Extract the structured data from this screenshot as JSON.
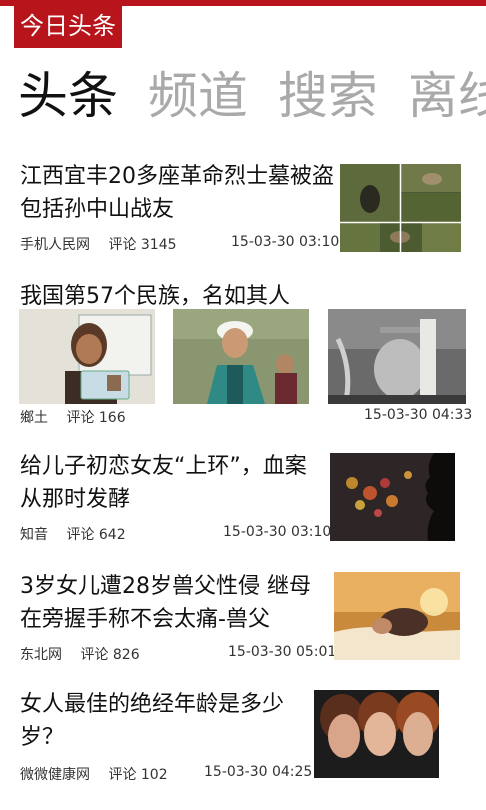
{
  "app": {
    "brand": "今日头条"
  },
  "tabs": [
    {
      "label": "头条",
      "active": true
    },
    {
      "label": "频道",
      "active": false
    },
    {
      "label": "搜索",
      "active": false
    },
    {
      "label": "离线",
      "active": false
    }
  ],
  "articles": [
    {
      "title": "江西宜丰20多座革命烈士墓被盗 包括孙中山战友",
      "source": "手机人民网",
      "comments": "评论 3145",
      "time": "15-03-30 03:10",
      "image": "graves-collage-image"
    },
    {
      "title": "我国第57个民族，名如其人",
      "source": "鄉土",
      "comments": "评论 166",
      "time": "15-03-30 04:33",
      "images": [
        "woman-id-card-image",
        "woman-traditional-dress-image",
        "bamboo-basket-image"
      ]
    },
    {
      "title": "给儿子初恋女友“上环”，血案从那时发酵",
      "source": "知音",
      "comments": "评论 642",
      "time": "15-03-30 03:10",
      "image": "silhouette-bokeh-image"
    },
    {
      "title": "3岁女儿遭28岁兽父性侵 继母在旁握手称不会太痛-兽父",
      "source": "东北网",
      "comments": "评论 826",
      "time": "15-03-30 05:01",
      "image": "bedroom-image"
    },
    {
      "title": "女人最佳的绝经年龄是多少岁？",
      "source": "微微健康网",
      "comments": "评论 102",
      "time": "15-03-30 04:25",
      "image": "three-women-faces-image"
    }
  ]
}
